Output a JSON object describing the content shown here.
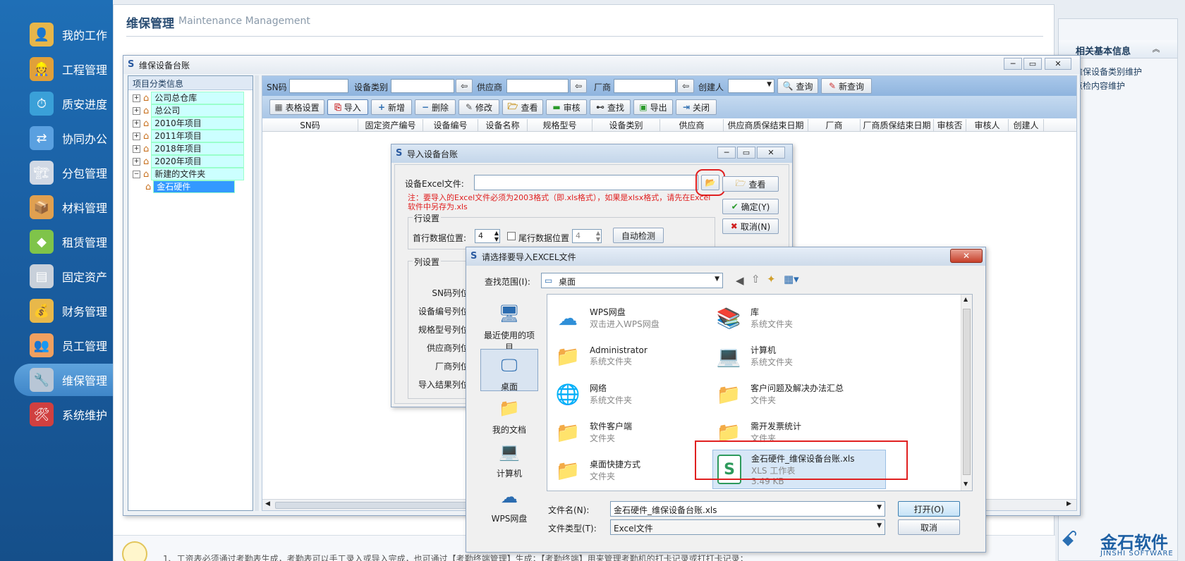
{
  "sidebar": {
    "items": [
      {
        "label": "我的工作",
        "icon": "user-work-icon",
        "glyph": "👤"
      },
      {
        "label": "工程管理",
        "icon": "engineer-icon",
        "glyph": "👷"
      },
      {
        "label": "质安进度",
        "icon": "clock-progress-icon",
        "glyph": "⏱"
      },
      {
        "label": "协同办公",
        "icon": "collab-icon",
        "glyph": "⇄"
      },
      {
        "label": "分包管理",
        "icon": "subcontract-icon",
        "glyph": "🏗"
      },
      {
        "label": "材料管理",
        "icon": "material-box-icon",
        "glyph": "📦"
      },
      {
        "label": "租赁管理",
        "icon": "lease-cubes-icon",
        "glyph": "◆"
      },
      {
        "label": "固定资产",
        "icon": "server-asset-icon",
        "glyph": "▤"
      },
      {
        "label": "财务管理",
        "icon": "finance-icon",
        "glyph": "💰"
      },
      {
        "label": "员工管理",
        "icon": "staff-icon",
        "glyph": "👥"
      },
      {
        "label": "维保管理",
        "icon": "wrench-icon",
        "glyph": "🔧"
      },
      {
        "label": "系统维护",
        "icon": "system-card-icon",
        "glyph": "🛠"
      }
    ]
  },
  "header": {
    "title": "维保管理",
    "subtitle": "Maintenance Management"
  },
  "right_panel": {
    "title": "相关基本信息",
    "links": [
      "维保设备类别维护",
      "点检内容维护"
    ]
  },
  "ledger_window": {
    "title": "维保设备台账",
    "tree_title": "项目分类信息",
    "tree": [
      {
        "label": "公司总仓库",
        "pm": "+"
      },
      {
        "label": "总公司",
        "pm": "+"
      },
      {
        "label": "2010年项目",
        "pm": "+"
      },
      {
        "label": "2011年项目",
        "pm": "+"
      },
      {
        "label": "2018年项目",
        "pm": "+"
      },
      {
        "label": "2020年项目",
        "pm": "+"
      },
      {
        "label": "新建的文件夹",
        "pm": "−"
      },
      {
        "label": "金石硬件",
        "pm": ""
      }
    ],
    "filters": {
      "sn": "SN码",
      "category": "设备类别",
      "supplier": "供应商",
      "vendor": "厂商",
      "creator": "创建人",
      "query": "查询",
      "new_query": "新查询"
    },
    "toolbar": [
      "表格设置",
      "导入",
      "新增",
      "删除",
      "修改",
      "查看",
      "审核",
      "查找",
      "导出",
      "关闭"
    ],
    "columns": [
      "SN码",
      "固定资产编号",
      "设备编号",
      "设备名称",
      "规格型号",
      "设备类别",
      "供应商",
      "供应商质保结束日期",
      "厂商",
      "厂商质保结束日期",
      "审核否",
      "审核人",
      "创建人"
    ]
  },
  "import_dialog": {
    "title": "导入设备台账",
    "file_label": "设备Excel文件:",
    "note": "注：要导入的Excel文件必须为2003格式（即.xls格式），如果是xlsx格式，请先在Excel软件中另存为.xls",
    "view": "查看",
    "ok": "确定(Y)",
    "cancel": "取消(N)",
    "row_settings": "行设置",
    "first_row_label": "首行数据位置:",
    "first_row_value": "4",
    "last_row_label": "尾行数据位置",
    "last_row_value": "4",
    "auto_detect": "自动检测",
    "col_settings": "列设置",
    "col_labels": [
      "SN码列位置",
      "设备编号列位置",
      "规格型号列位置",
      "供应商列位置",
      "厂商列位置",
      "导入结果列位置"
    ]
  },
  "file_dialog": {
    "title": "请选择要导入EXCEL文件",
    "lookin_label": "查找范围(I):",
    "lookin_value": "桌面",
    "places": [
      {
        "label": "最近使用的项目",
        "glyph": "🖥"
      },
      {
        "label": "桌面",
        "glyph": "🖵"
      },
      {
        "label": "我的文档",
        "glyph": "📁"
      },
      {
        "label": "计算机",
        "glyph": "💻"
      },
      {
        "label": "WPS网盘",
        "glyph": "☁"
      }
    ],
    "files": [
      {
        "name": "WPS网盘",
        "desc": "双击进入WPS网盘",
        "glyph": "☁",
        "color": "#2f8fd8"
      },
      {
        "name": "库",
        "desc": "系统文件夹",
        "glyph": "📚",
        "color": "#e0a73a"
      },
      {
        "name": "Administrator",
        "desc": "系统文件夹",
        "glyph": "📁",
        "color": "#e7c15a"
      },
      {
        "name": "计算机",
        "desc": "系统文件夹",
        "glyph": "💻",
        "color": "#3a6ea8"
      },
      {
        "name": "网络",
        "desc": "系统文件夹",
        "glyph": "🌐",
        "color": "#2b7fc9"
      },
      {
        "name": "客户问题及解决办法汇总",
        "desc": "文件夹",
        "glyph": "📁",
        "color": "#e7c15a"
      },
      {
        "name": "软件客户端",
        "desc": "文件夹",
        "glyph": "📁",
        "color": "#e7c15a"
      },
      {
        "name": "需开发票统计",
        "desc": "文件夹",
        "glyph": "📁",
        "color": "#e7c15a"
      },
      {
        "name": "桌面快捷方式",
        "desc": "文件夹",
        "glyph": "📁",
        "color": "#e7c15a"
      },
      {
        "name": "金石硬件_维保设备台账.xls",
        "desc": "XLS 工作表",
        "size": "3.49 KB",
        "glyph": "S",
        "color": "#2e9a5c"
      }
    ],
    "filename_label": "文件名(N):",
    "filename_value": "金石硬件_维保设备台账.xls",
    "filetype_label": "文件类型(T):",
    "filetype_value": "Excel文件",
    "open": "打开(O)",
    "cancel": "取消"
  },
  "brand": {
    "name": "金石软件",
    "sub": "JINSHI SOFTWARE"
  },
  "footer_hint": "1、工资表必须通过考勤表生成，考勤表可以手工录入或导入完成，也可通过【考勤终端管理】生成；【考勤终端】用来管理考勤机的打卡记录或打打卡记录；"
}
